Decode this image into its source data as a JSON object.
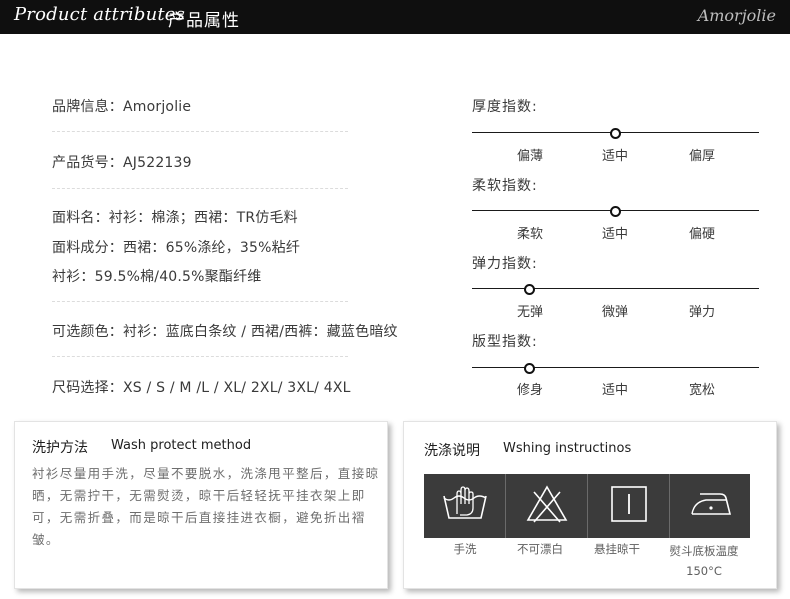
{
  "header": {
    "title_en": "Product attributes",
    "title_cn": "产品属性",
    "brand": "Amorjolie"
  },
  "attributes": {
    "brand": "品牌信息：Amorjolie",
    "item_no": "产品货号：AJ522139",
    "fabric_name": "面料名：衬衫：棉涤；西裙：TR仿毛料",
    "fabric_composition": "面料成分：西裙：65%涤纶，35%粘纤",
    "shirt_composition": "衬衫：59.5%棉/40.5%聚酯纤维",
    "colors": "可选颜色：衬衫：蓝底白条纹 / 西裙/西裤：藏蓝色暗纹",
    "sizes": "尺码选择：XS / S / M  /L / XL/  2XL/  3XL/  4XL"
  },
  "indices": [
    {
      "title": "厚度指数:",
      "labels": [
        "偏薄",
        "适中",
        "偏厚"
      ],
      "level": 0.5
    },
    {
      "title": "柔软指数:",
      "labels": [
        "柔软",
        "适中",
        "偏硬"
      ],
      "level": 0.5
    },
    {
      "title": "弹力指数:",
      "labels": [
        "无弹",
        "微弹",
        "弹力"
      ],
      "level": 0.2
    },
    {
      "title": "版型指数:",
      "labels": [
        "修身",
        "适中",
        "宽松"
      ],
      "level": 0.2
    }
  ],
  "care": {
    "title_cn": "洗护方法",
    "title_en": "Wash protect method",
    "text": "衬衫尽量用手洗，尽量不要脱水，洗涤甩平整后，直接晾晒，无需拧干，无需熨烫，晾干后轻轻抚平挂衣架上即可，无需折叠，而是晾干后直接挂进衣橱，避免折出褶皱。"
  },
  "washing": {
    "title_cn": "洗涤说明",
    "title_en": "Wshing instructinos",
    "items": [
      {
        "icon": "hand-wash-icon",
        "label": "手洗"
      },
      {
        "icon": "no-bleach-icon",
        "label": "不可漂白"
      },
      {
        "icon": "hang-dry-icon",
        "label": "悬挂晾干"
      },
      {
        "icon": "iron-icon",
        "label": "熨斗底板温度150°C"
      }
    ]
  },
  "colors": {
    "header_bg": "#0f0f0f",
    "wash_panel_bg": "#3b3b3b"
  }
}
